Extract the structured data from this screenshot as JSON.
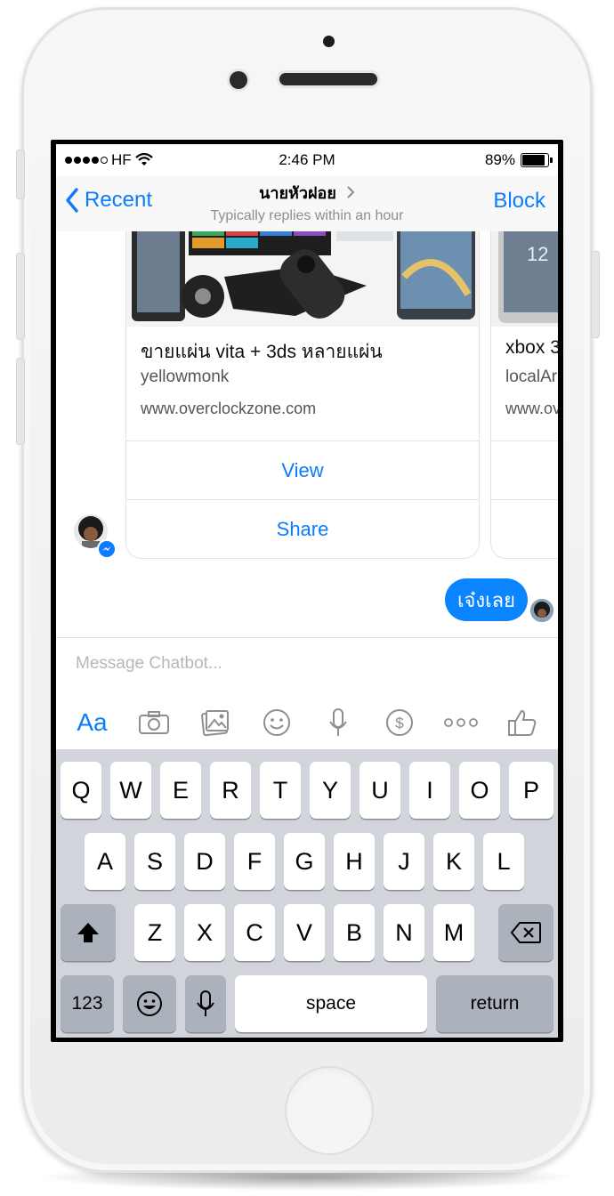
{
  "status_bar": {
    "carrier": "HF",
    "time": "2:46 PM",
    "battery_percent": "89%",
    "battery_level": 0.89
  },
  "nav": {
    "back_label": "Recent",
    "title": "นายหัวฝอย",
    "subtitle": "Typically replies within an hour",
    "block_label": "Block"
  },
  "cards": [
    {
      "title": "ขายแผ่น vita + 3ds หลายแผ่น",
      "subtitle": "yellowmonk",
      "url": "www.overclockzone.com",
      "buttons": [
        "View",
        "Share"
      ]
    },
    {
      "title": "xbox 3",
      "subtitle": "localAr",
      "url": "www.ov"
    }
  ],
  "outgoing_message": "เจ๋งเลย",
  "composer": {
    "placeholder": "Message Chatbot...",
    "aa_label": "Aa"
  },
  "keyboard": {
    "row1": [
      "Q",
      "W",
      "E",
      "R",
      "T",
      "Y",
      "U",
      "I",
      "O",
      "P"
    ],
    "row2": [
      "A",
      "S",
      "D",
      "F",
      "G",
      "H",
      "J",
      "K",
      "L"
    ],
    "row3": [
      "Z",
      "X",
      "C",
      "V",
      "B",
      "N",
      "M"
    ],
    "num_label": "123",
    "space_label": "space",
    "return_label": "return"
  },
  "colors": {
    "accent": "#0b7cff",
    "bubble": "#0b84ff",
    "keyboard_bg": "#d1d5db"
  },
  "icons": [
    "chevron-left-icon",
    "wifi-icon",
    "battery-icon",
    "camera-icon",
    "gallery-icon",
    "emoji-icon",
    "mic-icon",
    "dollar-icon",
    "more-icon",
    "like-icon",
    "shift-icon",
    "backspace-icon",
    "keyboard-emoji-icon",
    "keyboard-mic-icon",
    "messenger-badge-icon"
  ]
}
